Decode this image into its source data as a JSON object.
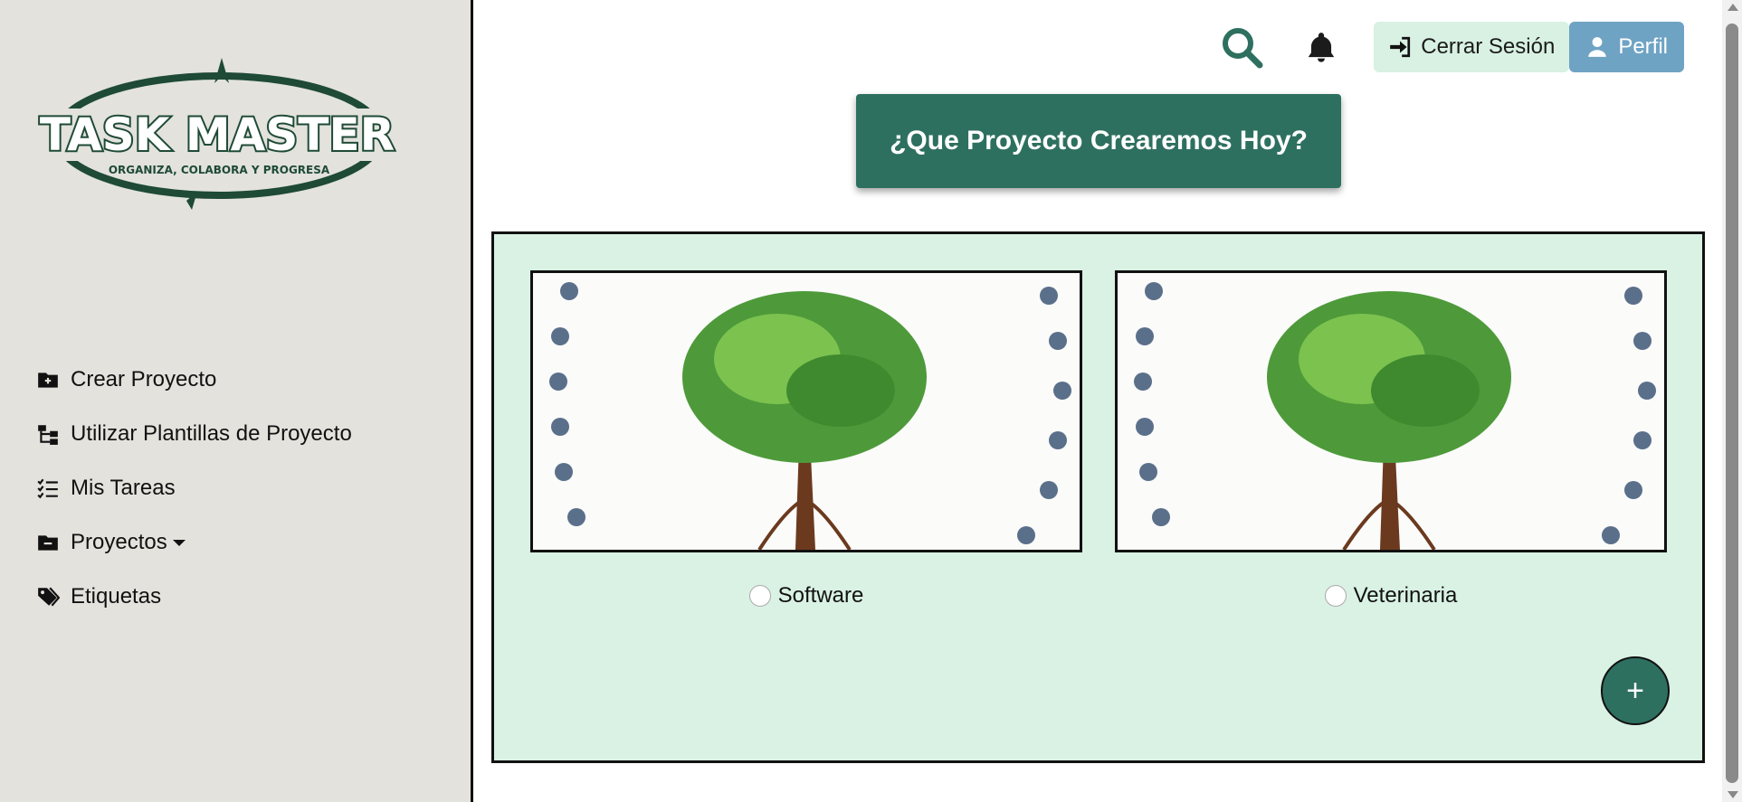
{
  "logo": {
    "title": "TASK MASTER",
    "tagline": "ORGANIZA, COLABORA Y PROGRESA"
  },
  "sidebar": {
    "items": [
      {
        "label": "Crear Proyecto",
        "icon": "folder-plus-icon"
      },
      {
        "label": "Utilizar Plantillas de Proyecto",
        "icon": "sitemap-icon"
      },
      {
        "label": "Mis Tareas",
        "icon": "list-check-icon"
      },
      {
        "label": "Proyectos",
        "icon": "folder-minus-icon"
      },
      {
        "label": "Etiquetas",
        "icon": "tags-icon"
      }
    ]
  },
  "header": {
    "search_icon": "search-icon",
    "bell_icon": "bell-icon",
    "logout_label": "Cerrar Sesión",
    "profile_label": "Perfil"
  },
  "main": {
    "heading": "¿Que Proyecto Crearemos Hoy?",
    "templates": [
      {
        "label": "Software"
      },
      {
        "label": "Veterinaria"
      }
    ],
    "add_label": "+"
  },
  "colors": {
    "primary": "#2e7060",
    "panel": "#d9f2e4",
    "sidebar": "#e3e2dd",
    "profile": "#6fa3c4",
    "logout": "#d8f1e3"
  }
}
